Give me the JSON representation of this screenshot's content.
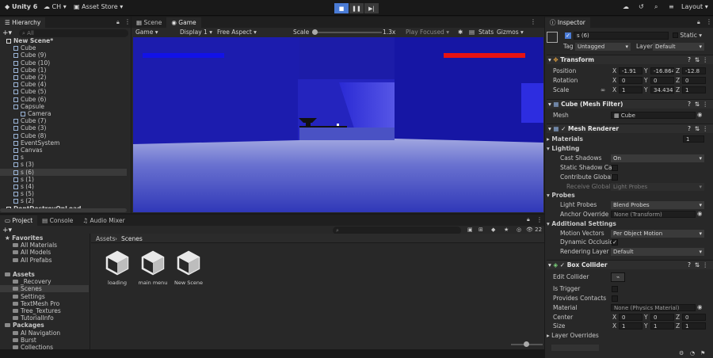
{
  "topbar": {
    "app": "Unity 6",
    "account": "CH",
    "asset_store": "Asset Store",
    "layout": "Layout"
  },
  "hierarchy": {
    "tab": "Hierarchy",
    "search_placeholder": "All",
    "items": [
      {
        "label": "New Scene*",
        "indent": 0
      },
      {
        "label": "Cube",
        "indent": 1
      },
      {
        "label": "Cube (9)",
        "indent": 1
      },
      {
        "label": "Cube (10)",
        "indent": 1
      },
      {
        "label": "Cube (1)",
        "indent": 1
      },
      {
        "label": "Cube (2)",
        "indent": 1
      },
      {
        "label": "Cube (4)",
        "indent": 1
      },
      {
        "label": "Cube (5)",
        "indent": 1
      },
      {
        "label": "Cube (6)",
        "indent": 1
      },
      {
        "label": "Capsule",
        "indent": 1
      },
      {
        "label": "Camera",
        "indent": 2
      },
      {
        "label": "Cube (7)",
        "indent": 1
      },
      {
        "label": "Cube (3)",
        "indent": 1
      },
      {
        "label": "Cube (8)",
        "indent": 1
      },
      {
        "label": "EventSystem",
        "indent": 1
      },
      {
        "label": "Canvas",
        "indent": 1
      },
      {
        "label": "s",
        "indent": 1
      },
      {
        "label": "s (3)",
        "indent": 1
      },
      {
        "label": "s (6)",
        "indent": 1
      },
      {
        "label": "s (1)",
        "indent": 1
      },
      {
        "label": "s (4)",
        "indent": 1
      },
      {
        "label": "s (5)",
        "indent": 1
      },
      {
        "label": "s (2)",
        "indent": 1
      },
      {
        "label": "DontDestroyOnLoad",
        "indent": 0
      }
    ],
    "selected_index": 18
  },
  "view_tabs": {
    "scene": "Scene",
    "game": "Game"
  },
  "game_toolbar": {
    "display_mode": "Game",
    "display": "Display 1",
    "aspect": "Free Aspect",
    "scale_label": "Scale",
    "scale_value": "1.3x",
    "play_focused": "Play Focused",
    "stats": "Stats",
    "gizmos": "Gizmos"
  },
  "bottom_tabs": {
    "project": "Project",
    "console": "Console",
    "audio_mixer": "Audio Mixer"
  },
  "project": {
    "breadcrumb_root": "Assets",
    "breadcrumb_current": "Scenes",
    "count": "22",
    "tree": [
      {
        "label": "Favorites",
        "indent": 0,
        "bold": true
      },
      {
        "label": "All Materials",
        "indent": 1
      },
      {
        "label": "All Models",
        "indent": 1
      },
      {
        "label": "All Prefabs",
        "indent": 1
      },
      {
        "label": "",
        "indent": 0
      },
      {
        "label": "Assets",
        "indent": 0,
        "bold": true
      },
      {
        "label": "_Recovery",
        "indent": 1
      },
      {
        "label": "Scenes",
        "indent": 1
      },
      {
        "label": "Settings",
        "indent": 1
      },
      {
        "label": "TextMesh Pro",
        "indent": 1
      },
      {
        "label": "Tree_Textures",
        "indent": 1
      },
      {
        "label": "TutorialInfo",
        "indent": 1
      },
      {
        "label": "Packages",
        "indent": 0,
        "bold": true
      },
      {
        "label": "AI Navigation",
        "indent": 1
      },
      {
        "label": "Burst",
        "indent": 1
      },
      {
        "label": "Collections",
        "indent": 1
      }
    ],
    "assets": [
      "loading",
      "main menu",
      "New Scene"
    ]
  },
  "inspector": {
    "tab": "Inspector",
    "object_name": "s (6)",
    "static_label": "Static",
    "tag_label": "Tag",
    "tag_value": "Untagged",
    "layer_label": "Layer",
    "layer_value": "Default",
    "transform": {
      "title": "Transform",
      "position_label": "Position",
      "rotation_label": "Rotation",
      "scale_label": "Scale",
      "position": [
        "-1.91",
        "-16.864",
        "-12.8"
      ],
      "rotation": [
        "0",
        "0",
        "0"
      ],
      "scale": [
        "1",
        "34.4348",
        "1"
      ]
    },
    "mesh_filter": {
      "title": "Cube (Mesh Filter)",
      "mesh_label": "Mesh",
      "mesh_value": "Cube"
    },
    "mesh_renderer": {
      "title": "Mesh Renderer",
      "materials_label": "Materials",
      "materials_count": "1",
      "lighting_label": "Lighting",
      "cast_shadows_label": "Cast Shadows",
      "cast_shadows_value": "On",
      "static_shadow_label": "Static Shadow Cast",
      "contribute_gi_label": "Contribute Global Il",
      "receive_gi_label": "Receive Global Il",
      "receive_gi_value": "Light Probes",
      "probes_label": "Probes",
      "light_probes_label": "Light Probes",
      "light_probes_value": "Blend Probes",
      "anchor_override_label": "Anchor Override",
      "anchor_override_value": "None (Transform)",
      "additional_label": "Additional Settings",
      "motion_vectors_label": "Motion Vectors",
      "motion_vectors_value": "Per Object Motion",
      "dynamic_occlusion_label": "Dynamic Occlusion",
      "rendering_layer_label": "Rendering Layer M",
      "rendering_layer_value": "Default"
    },
    "box_collider": {
      "title": "Box Collider",
      "edit_collider_label": "Edit Collider",
      "is_trigger_label": "Is Trigger",
      "provides_contacts_label": "Provides Contacts",
      "material_label": "Material",
      "material_value": "None (Physics Material)",
      "center_label": "Center",
      "center": [
        "0",
        "0",
        "0"
      ],
      "size_label": "Size",
      "size": [
        "1",
        "1",
        "1"
      ],
      "layer_overrides_label": "Layer Overrides"
    }
  },
  "colors": {
    "sky": "#1a1ab8",
    "floor": "#5a63c8",
    "blue_bar": "#1212e8",
    "red_bar": "#e81212",
    "accent": "#4a7bd5"
  }
}
